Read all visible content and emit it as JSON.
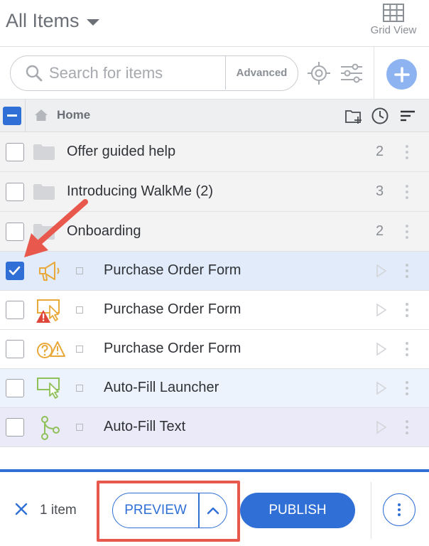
{
  "header": {
    "title": "All Items",
    "grid_view_label": "Grid View"
  },
  "search": {
    "placeholder": "Search for items",
    "advanced_label": "Advanced"
  },
  "table_header": {
    "breadcrumb": "Home"
  },
  "folders": [
    {
      "label": "Offer guided help",
      "count": "2"
    },
    {
      "label": "Introducing WalkMe (2)",
      "count": "3"
    },
    {
      "label": "Onboarding",
      "count": "2"
    }
  ],
  "items": [
    {
      "label": "Purchase Order Form",
      "icon": "megaphone-icon",
      "checked": true
    },
    {
      "label": "Purchase Order Form",
      "icon": "warning-launcher-icon",
      "checked": false
    },
    {
      "label": "Purchase Order Form",
      "icon": "question-warning-icon",
      "checked": false
    },
    {
      "label": "Auto-Fill Launcher",
      "icon": "launcher-icon",
      "checked": false
    },
    {
      "label": "Auto-Fill Text",
      "icon": "flow-branch-icon",
      "checked": false
    }
  ],
  "footer": {
    "selected_count": "1 item",
    "preview_label": "PREVIEW",
    "publish_label": "PUBLISH"
  },
  "colors": {
    "accent": "#2f6fd6",
    "annotation_red": "#e8584c",
    "selected_row": "#e1ebfa",
    "icon_orange": "#e8a93a",
    "icon_green": "#8fc05a"
  }
}
